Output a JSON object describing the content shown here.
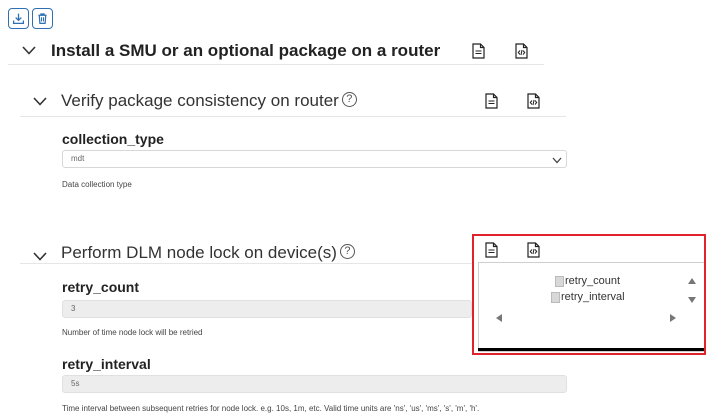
{
  "toolbar": {
    "download_icon": "download-icon",
    "delete_icon": "trash-icon"
  },
  "sections": {
    "install": {
      "title": "Install a SMU or an optional package on a router"
    },
    "verify": {
      "title": "Verify package consistency on router",
      "help_glyph": "?",
      "collection_type": {
        "label": "collection_type",
        "value": "mdt",
        "help": "Data collection type"
      }
    },
    "dlm": {
      "title": "Perform DLM node lock on device(s)",
      "help_glyph": "?",
      "retry_count": {
        "label": "retry_count",
        "value": "3",
        "help": "Number of time node lock will be retried"
      },
      "retry_interval": {
        "label": "retry_interval",
        "value": "5s",
        "help": "Time interval between subsequent retries for node lock. e.g. 10s, 1m, etc. Valid time units are 'ns', 'us', 'ms', 's', 'm', 'h'."
      }
    }
  },
  "popup": {
    "items": [
      "retry_count",
      "retry_interval"
    ]
  },
  "colors": {
    "accent": "#2f6fb3",
    "highlight": "#e0232b"
  }
}
